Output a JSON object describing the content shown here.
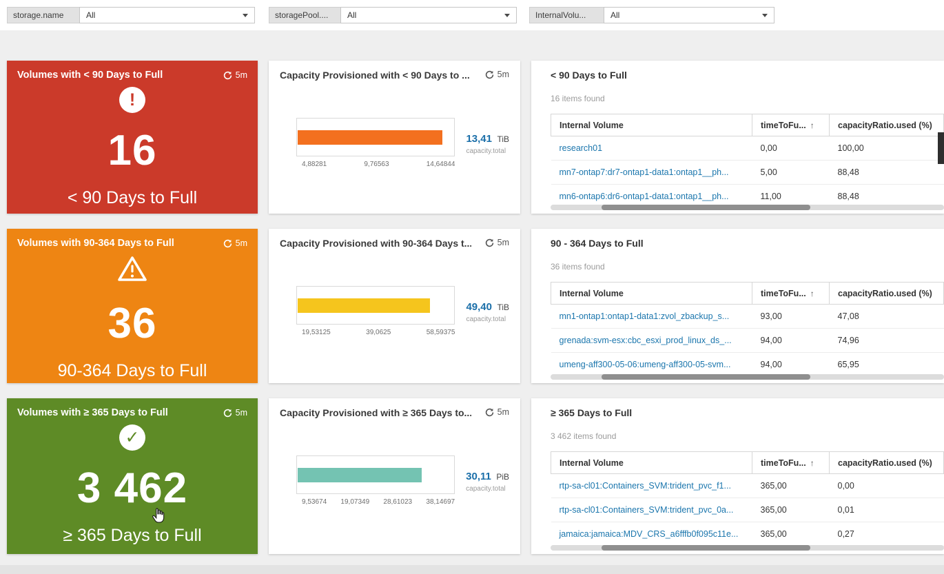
{
  "filters": [
    {
      "label": "storage.name",
      "value": "All"
    },
    {
      "label": "storagePool....",
      "value": "All"
    },
    {
      "label": "InternalVolu...",
      "value": "All"
    }
  ],
  "refresh_interval": "5m",
  "sort_indicator": "↑",
  "colors": {
    "value_blue": "#1b6fa9",
    "link_blue": "#1b76ad",
    "kpi_red": "#cb3a2a",
    "kpi_orange": "#ee8513",
    "kpi_green": "#5e8b26",
    "bar_orange": "#f3701f",
    "bar_yellow": "#f5c51d",
    "bar_teal": "#74c3b2"
  },
  "rows": [
    {
      "kpi": {
        "title": "Volumes with < 90 Days to Full",
        "glyph": "!",
        "value": "16",
        "label": "< 90 Days to Full",
        "color": "#cb3a2a"
      },
      "chart": {
        "title": "Capacity Provisioned with < 90 Days to ...",
        "value": "13,41",
        "unit": "TiB",
        "caption": "capacity.total",
        "bar_color": "#f3701f",
        "bar_width": "92%",
        "ticks": [
          "4,88281",
          "9,76563",
          "14,64844"
        ]
      },
      "table": {
        "title": "< 90 Days to Full",
        "items_found": "16 items found",
        "columns": [
          "Internal Volume",
          "timeToFu...",
          "capacityRatio.used (%)"
        ],
        "rows": [
          [
            "research01",
            "0,00",
            "100,00"
          ],
          [
            "mn7-ontap7:dr7-ontap1-data1:ontap1__ph...",
            "5,00",
            "88,48"
          ],
          [
            "mn6-ontap6:dr6-ontap1-data1:ontap1__ph...",
            "11,00",
            "88,48"
          ]
        ]
      }
    },
    {
      "kpi": {
        "title": "Volumes with 90-364 Days to Full",
        "glyph": "!",
        "value": "36",
        "label": "90-364 Days to Full",
        "color": "#ee8513"
      },
      "chart": {
        "title": "Capacity Provisioned with 90-364 Days t...",
        "value": "49,40",
        "unit": "TiB",
        "caption": "capacity.total",
        "bar_color": "#f5c51d",
        "bar_width": "84%",
        "ticks": [
          "19,53125",
          "39,0625",
          "58,59375"
        ]
      },
      "table": {
        "title": "90 - 364 Days to Full",
        "items_found": "36 items found",
        "columns": [
          "Internal Volume",
          "timeToFu...",
          "capacityRatio.used (%)"
        ],
        "rows": [
          [
            "mn1-ontap1:ontap1-data1:zvol_zbackup_s...",
            "93,00",
            "47,08"
          ],
          [
            "grenada:svm-esx:cbc_esxi_prod_linux_ds_...",
            "94,00",
            "74,96"
          ],
          [
            "umeng-aff300-05-06:umeng-aff300-05-svm...",
            "94,00",
            "65,95"
          ]
        ]
      }
    },
    {
      "kpi": {
        "title": "Volumes with ≥ 365 Days to Full",
        "glyph": "✓",
        "value": "3 462",
        "label": "≥ 365 Days to Full",
        "color": "#5e8b26"
      },
      "chart": {
        "title": "Capacity Provisioned with ≥ 365 Days to...",
        "value": "30,11",
        "unit": "PiB",
        "caption": "capacity.total",
        "bar_color": "#74c3b2",
        "bar_width": "79%",
        "ticks": [
          "9,53674",
          "19,07349",
          "28,61023",
          "38,14697"
        ]
      },
      "table": {
        "title": "≥ 365 Days to Full",
        "items_found": "3 462 items found",
        "columns": [
          "Internal Volume",
          "timeToFu...",
          "capacityRatio.used (%)"
        ],
        "rows": [
          [
            "rtp-sa-cl01:Containers_SVM:trident_pvc_f1...",
            "365,00",
            "0,00"
          ],
          [
            "rtp-sa-cl01:Containers_SVM:trident_pvc_0a...",
            "365,00",
            "0,01"
          ],
          [
            "jamaica:jamaica:MDV_CRS_a6fffb0f095c11e...",
            "365,00",
            "0,27"
          ]
        ]
      }
    }
  ]
}
